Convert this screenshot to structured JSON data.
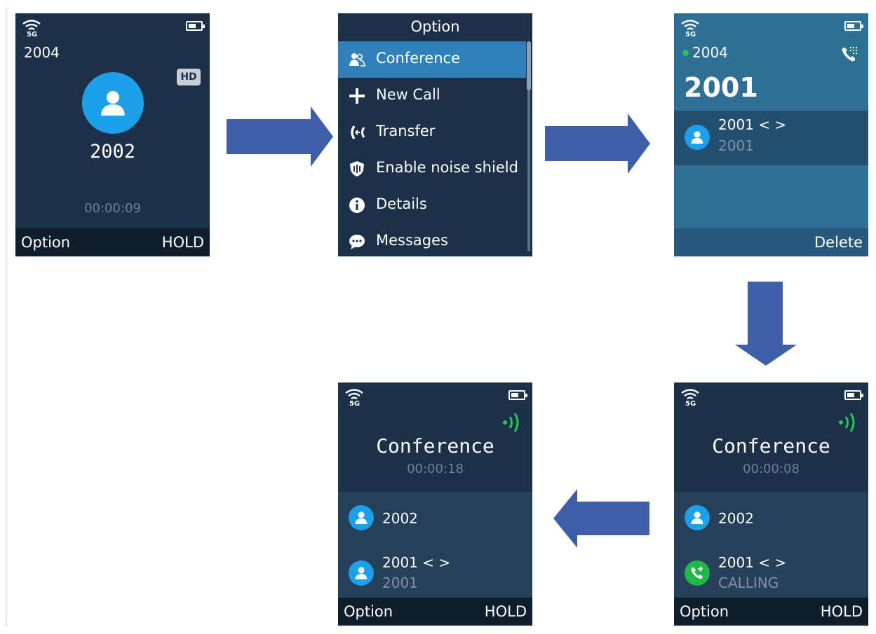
{
  "screen1": {
    "account": "2004",
    "hd_badge": "HD",
    "number": "2002",
    "timer": "00:00:09",
    "softkey_left": "Option",
    "softkey_right": "HOLD"
  },
  "screen2": {
    "title": "Option",
    "items": [
      {
        "label": "Conference",
        "icon": "conference-icon",
        "selected": true
      },
      {
        "label": "New Call",
        "icon": "plus-icon"
      },
      {
        "label": "Transfer",
        "icon": "transfer-icon"
      },
      {
        "label": "Enable noise shield",
        "icon": "noise-shield-icon"
      },
      {
        "label": "Details",
        "icon": "info-icon"
      },
      {
        "label": "Messages",
        "icon": "message-icon"
      }
    ]
  },
  "screen3": {
    "account": "2004",
    "dialed": "2001",
    "entry_name": "2001 < >",
    "entry_number": "2001",
    "softkey_right": "Delete"
  },
  "screen4": {
    "title": "Conference",
    "timer": "00:00:18",
    "party1": "2002",
    "party2_name": "2001 < >",
    "party2_number": "2001",
    "softkey_left": "Option",
    "softkey_right": "HOLD"
  },
  "screen5": {
    "title": "Conference",
    "timer": "00:00:08",
    "party1": "2002",
    "party2_name": "2001 < >",
    "party2_status": "CALLING",
    "softkey_left": "Option",
    "softkey_right": "HOLD"
  },
  "colors": {
    "screen_bg": "#1c3048",
    "highlight": "#3080b9",
    "dial_bg": "#2f6f96",
    "avatar": "#1e9fea",
    "arrow": "#3f5ea8",
    "active_green": "#22c55e"
  }
}
